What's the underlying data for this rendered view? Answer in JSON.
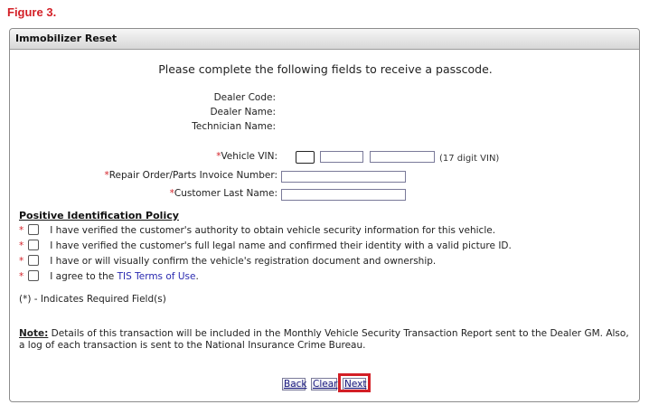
{
  "figure_label": "Figure 3.",
  "panel": {
    "title": "Immobilizer Reset"
  },
  "intro": "Please complete the following fields to receive a passcode.",
  "info": {
    "dealer_code_label": "Dealer Code:",
    "dealer_name_label": "Dealer Name:",
    "technician_name_label": "Technician Name:"
  },
  "form": {
    "required_marker": "*",
    "vin_label": "Vehicle VIN:",
    "vin_hint": "(17 digit VIN)",
    "repair_order_label": "Repair Order/Parts Invoice Number:",
    "customer_last_name_label": "Customer Last Name:",
    "vin_part1": "",
    "vin_part2": "",
    "vin_part3": "",
    "repair_order_value": "",
    "customer_last_name_value": ""
  },
  "policy": {
    "title": "Positive Identification Policy",
    "items": [
      {
        "text": "I have verified the customer's authority to obtain vehicle security information for this vehicle.",
        "checked": false
      },
      {
        "text": "I have verified the customer's full legal name and confirmed their identity with a valid picture ID.",
        "checked": false
      },
      {
        "text": "I have or will visually confirm the vehicle's registration document and ownership.",
        "checked": false
      },
      {
        "text_before": "I agree to the",
        "link": "TIS Terms of Use",
        "text_after": ".",
        "checked": false
      }
    ]
  },
  "required_legend": "(*) - Indicates Required Field(s)",
  "note": {
    "label": "Note:",
    "text": " Details of this transaction will be included in the Monthly Vehicle Security Transaction Report sent to the Dealer GM. Also, a log of each transaction is sent to the National Insurance Crime Bureau."
  },
  "buttons": {
    "back": "Back",
    "clear": "Clear",
    "next": "Next"
  },
  "colors": {
    "required": "#d31f26",
    "highlight": "#d31f26",
    "link": "#2a2ab0"
  }
}
